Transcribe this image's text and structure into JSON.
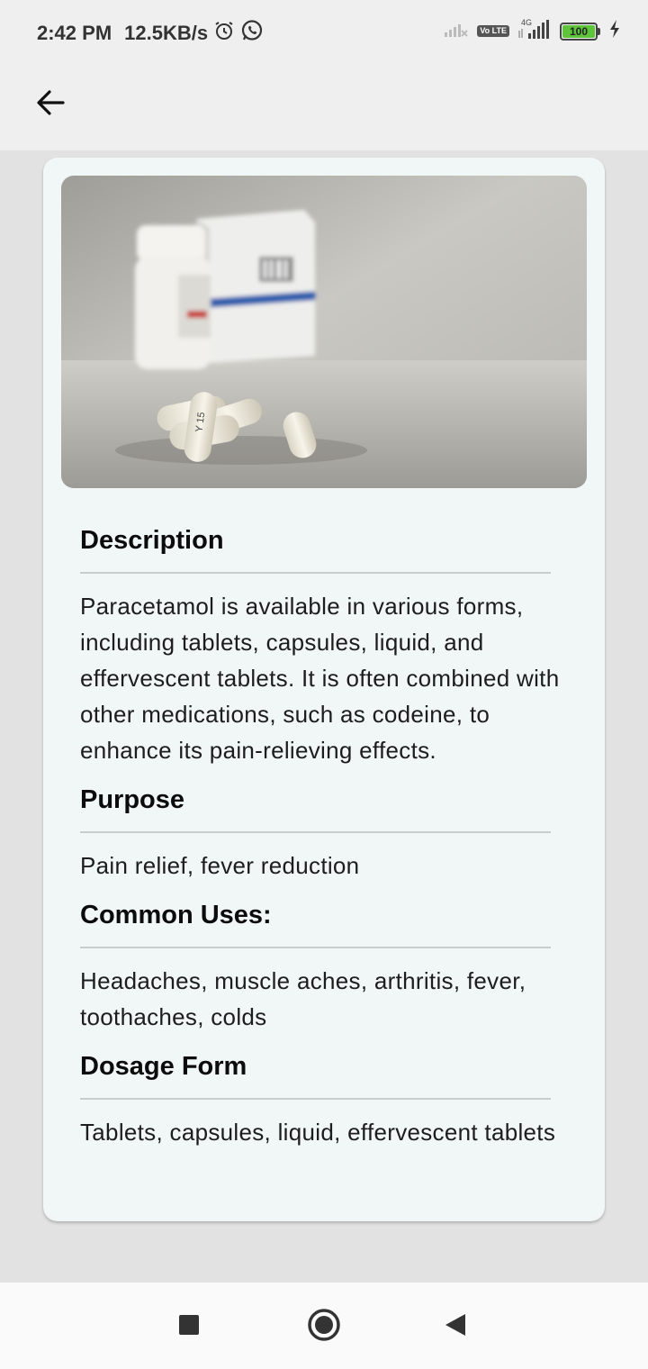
{
  "status_bar": {
    "time": "2:42 PM",
    "net_speed": "12.5KB/s",
    "icons": [
      "alarm-icon",
      "whatsapp-icon",
      "signal-no-service-icon",
      "volte-icon",
      "4g-signal-icon",
      "battery-icon",
      "charging-icon"
    ],
    "volte_label": "Vo LTE",
    "network_type": "4G",
    "battery_level": "100"
  },
  "app_bar": {
    "back_icon": "arrow-left-icon"
  },
  "product": {
    "image_alt": "pill-capsules-and-medicine-bottle-image",
    "sections": [
      {
        "title": "Description",
        "body": "Paracetamol is available in various forms, including tablets, capsules, liquid, and effervescent tablets. It is often combined with other medications, such as codeine, to enhance its pain-relieving effects."
      },
      {
        "title": "Purpose",
        "body": "Pain relief, fever reduction"
      },
      {
        "title": "Common Uses:",
        "body": "Headaches, muscle aches, arthritis, fever, toothaches, colds"
      },
      {
        "title": "Dosage Form",
        "body": "Tablets, capsules, liquid, effervescent tablets"
      }
    ]
  },
  "nav_bar": {
    "icons": [
      "recents-square-icon",
      "home-circle-icon",
      "back-triangle-icon"
    ]
  },
  "colors": {
    "card_background": "#f1f6f6",
    "page_background": "#e2e2e2",
    "battery_fill": "#5ec43a"
  }
}
